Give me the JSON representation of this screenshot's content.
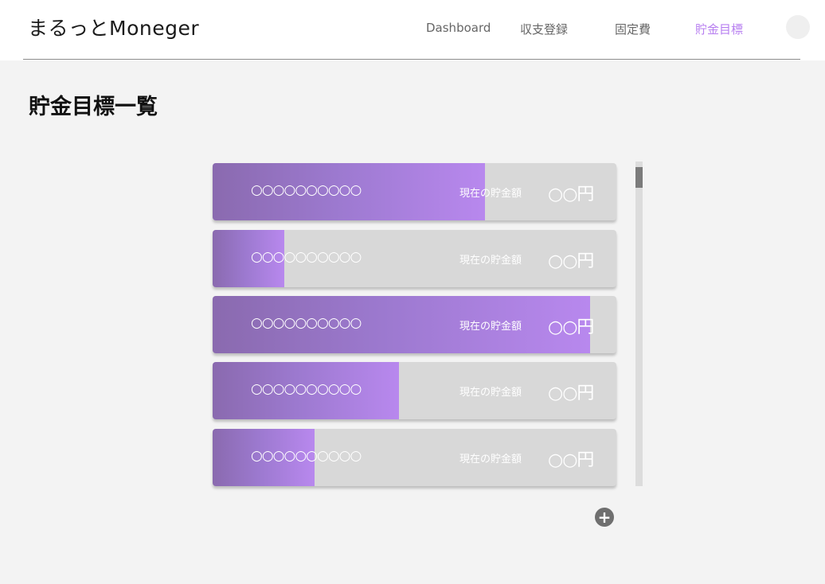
{
  "header": {
    "app_title": "まるっとMoneger",
    "nav": [
      {
        "label": "Dashboard",
        "active": false
      },
      {
        "label": "収支登録",
        "active": false
      },
      {
        "label": "固定費",
        "active": false
      },
      {
        "label": "貯金目標",
        "active": true
      }
    ]
  },
  "page": {
    "title": "貯金目標一覧"
  },
  "goals": [
    {
      "name": "○○○○○○○○○○",
      "label": "現在の貯金額",
      "amount": "○○円",
      "progress": 0.675
    },
    {
      "name": "○○○○○○○○○○",
      "label": "現在の貯金額",
      "amount": "○○円",
      "progress": 0.178
    },
    {
      "name": "○○○○○○○○○○",
      "label": "現在の貯金額",
      "amount": "○○円",
      "progress": 0.935
    },
    {
      "name": "○○○○○○○○○○",
      "label": "現在の貯金額",
      "amount": "○○円",
      "progress": 0.462
    },
    {
      "name": "○○○○○○○○○○",
      "label": "現在の貯金額",
      "amount": "○○円",
      "progress": 0.253
    }
  ],
  "add_button": {
    "icon": "plus-icon",
    "symbol": "+"
  },
  "colors": {
    "accent": "#b77ef0",
    "fill_start": "#8a6aaf",
    "fill_end": "#b888ee",
    "card_bg": "#d8d8d8"
  }
}
